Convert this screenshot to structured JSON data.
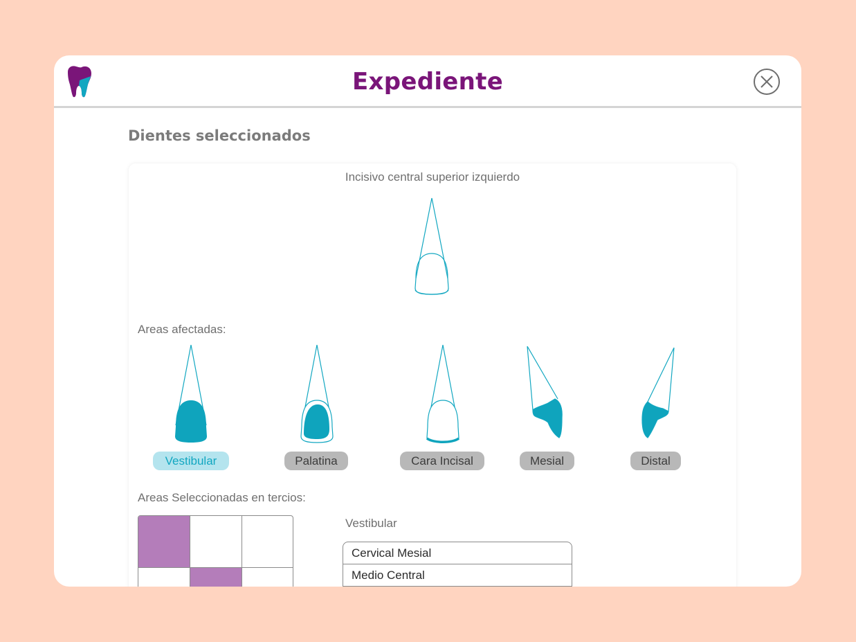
{
  "header": {
    "title": "Expediente"
  },
  "section_title": "Dientes seleccionados",
  "tooth": {
    "name": "Incisivo central superior izquierdo"
  },
  "areas": {
    "label": "Areas afectadas:",
    "items": [
      {
        "label": "Vestibular",
        "active": true
      },
      {
        "label": "Palatina",
        "active": false
      },
      {
        "label": "Cara Incisal",
        "active": false
      },
      {
        "label": "Mesial",
        "active": false
      },
      {
        "label": "Distal",
        "active": false
      }
    ]
  },
  "thirds": {
    "label": "Areas Seleccionadas en tercios:",
    "selected_area": "Vestibular",
    "grid_selected": [
      [
        true,
        false,
        false
      ],
      [
        false,
        true,
        false
      ],
      [
        false,
        false,
        false
      ]
    ],
    "list": [
      "Cervical Mesial",
      "Medio Central"
    ]
  },
  "colors": {
    "background": "#FFD4C0",
    "brand_purple": "#7A1579",
    "teal": "#0FA4BD",
    "selected_cell": "#B47DBA",
    "active_pill_bg": "#B4E4EE"
  }
}
